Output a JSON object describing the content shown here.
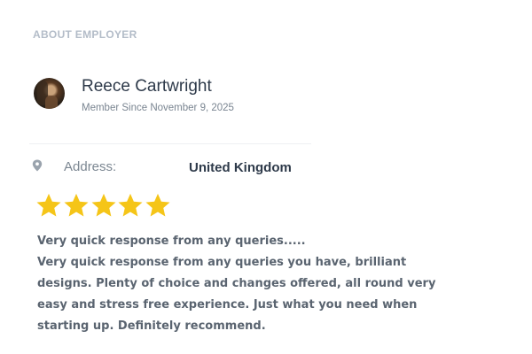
{
  "section_title": "About Employer",
  "employer": {
    "name": "Reece Cartwright",
    "member_since": "Member Since November 9, 2025"
  },
  "address": {
    "label": "Address:",
    "value": "United Kingdom",
    "icon": "map-pin-icon"
  },
  "rating": {
    "stars": 5,
    "max": 5,
    "color": "#f5c518"
  },
  "review": {
    "title": "Very quick response from any queries.....",
    "body": "Very quick response from any queries you have, brilliant designs. Plenty of choice and changes offered, all round very easy and stress free experience. Just what you need when starting up. Definitely recommend."
  }
}
